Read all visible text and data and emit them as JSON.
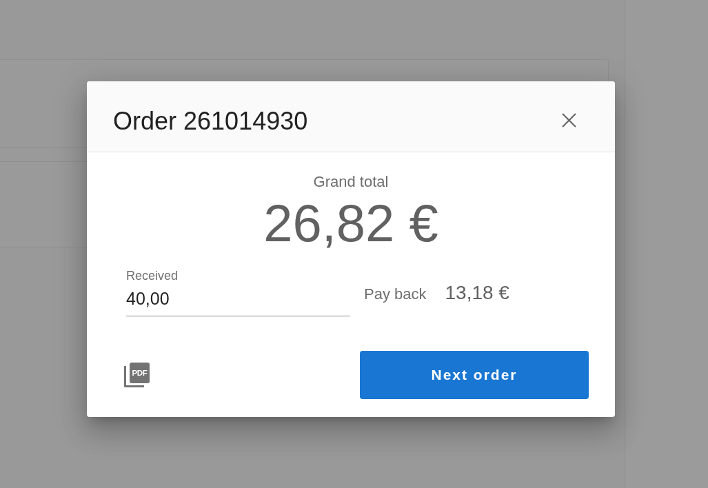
{
  "dialog": {
    "title": "Order 261014930",
    "grand_total": {
      "label": "Grand total",
      "amount": "26,82 €"
    },
    "received": {
      "label": "Received",
      "value": "40,00"
    },
    "pay_back": {
      "label": "Pay back",
      "amount": "13,18 €"
    },
    "pdf_button": {
      "label": "PDF"
    },
    "next_button": {
      "label": "Next order"
    }
  }
}
